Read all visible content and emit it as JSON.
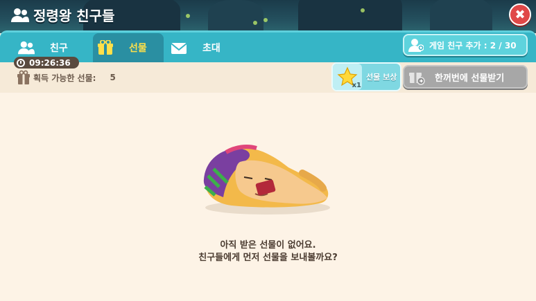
{
  "header": {
    "title": "정령왕 친구들"
  },
  "tabs": [
    {
      "label": "친구",
      "icon": "friends-icon"
    },
    {
      "label": "선물",
      "icon": "gift-icon",
      "active": true
    },
    {
      "label": "초대",
      "icon": "envelope-icon"
    }
  ],
  "add_friend": {
    "label": "게임 친구 추가 : 2 / 30"
  },
  "timer": {
    "value": "09:26:36"
  },
  "gift_available": {
    "label": "획득 가능한 선물:",
    "count": "5"
  },
  "reward": {
    "label": "선물 보상",
    "multiplier": "x1"
  },
  "receive_all": {
    "label": "한꺼번에 선물받기"
  },
  "empty": {
    "line1": "아직 받은 선물이 없어요.",
    "line2": "친구들에게 먼저 선물을 보내볼까요?"
  },
  "colors": {
    "tab_bar": "#36b5c6",
    "active_tab_text": "#ffe04a",
    "close": "#e04848",
    "disabled_button": "#a7a7a7"
  }
}
